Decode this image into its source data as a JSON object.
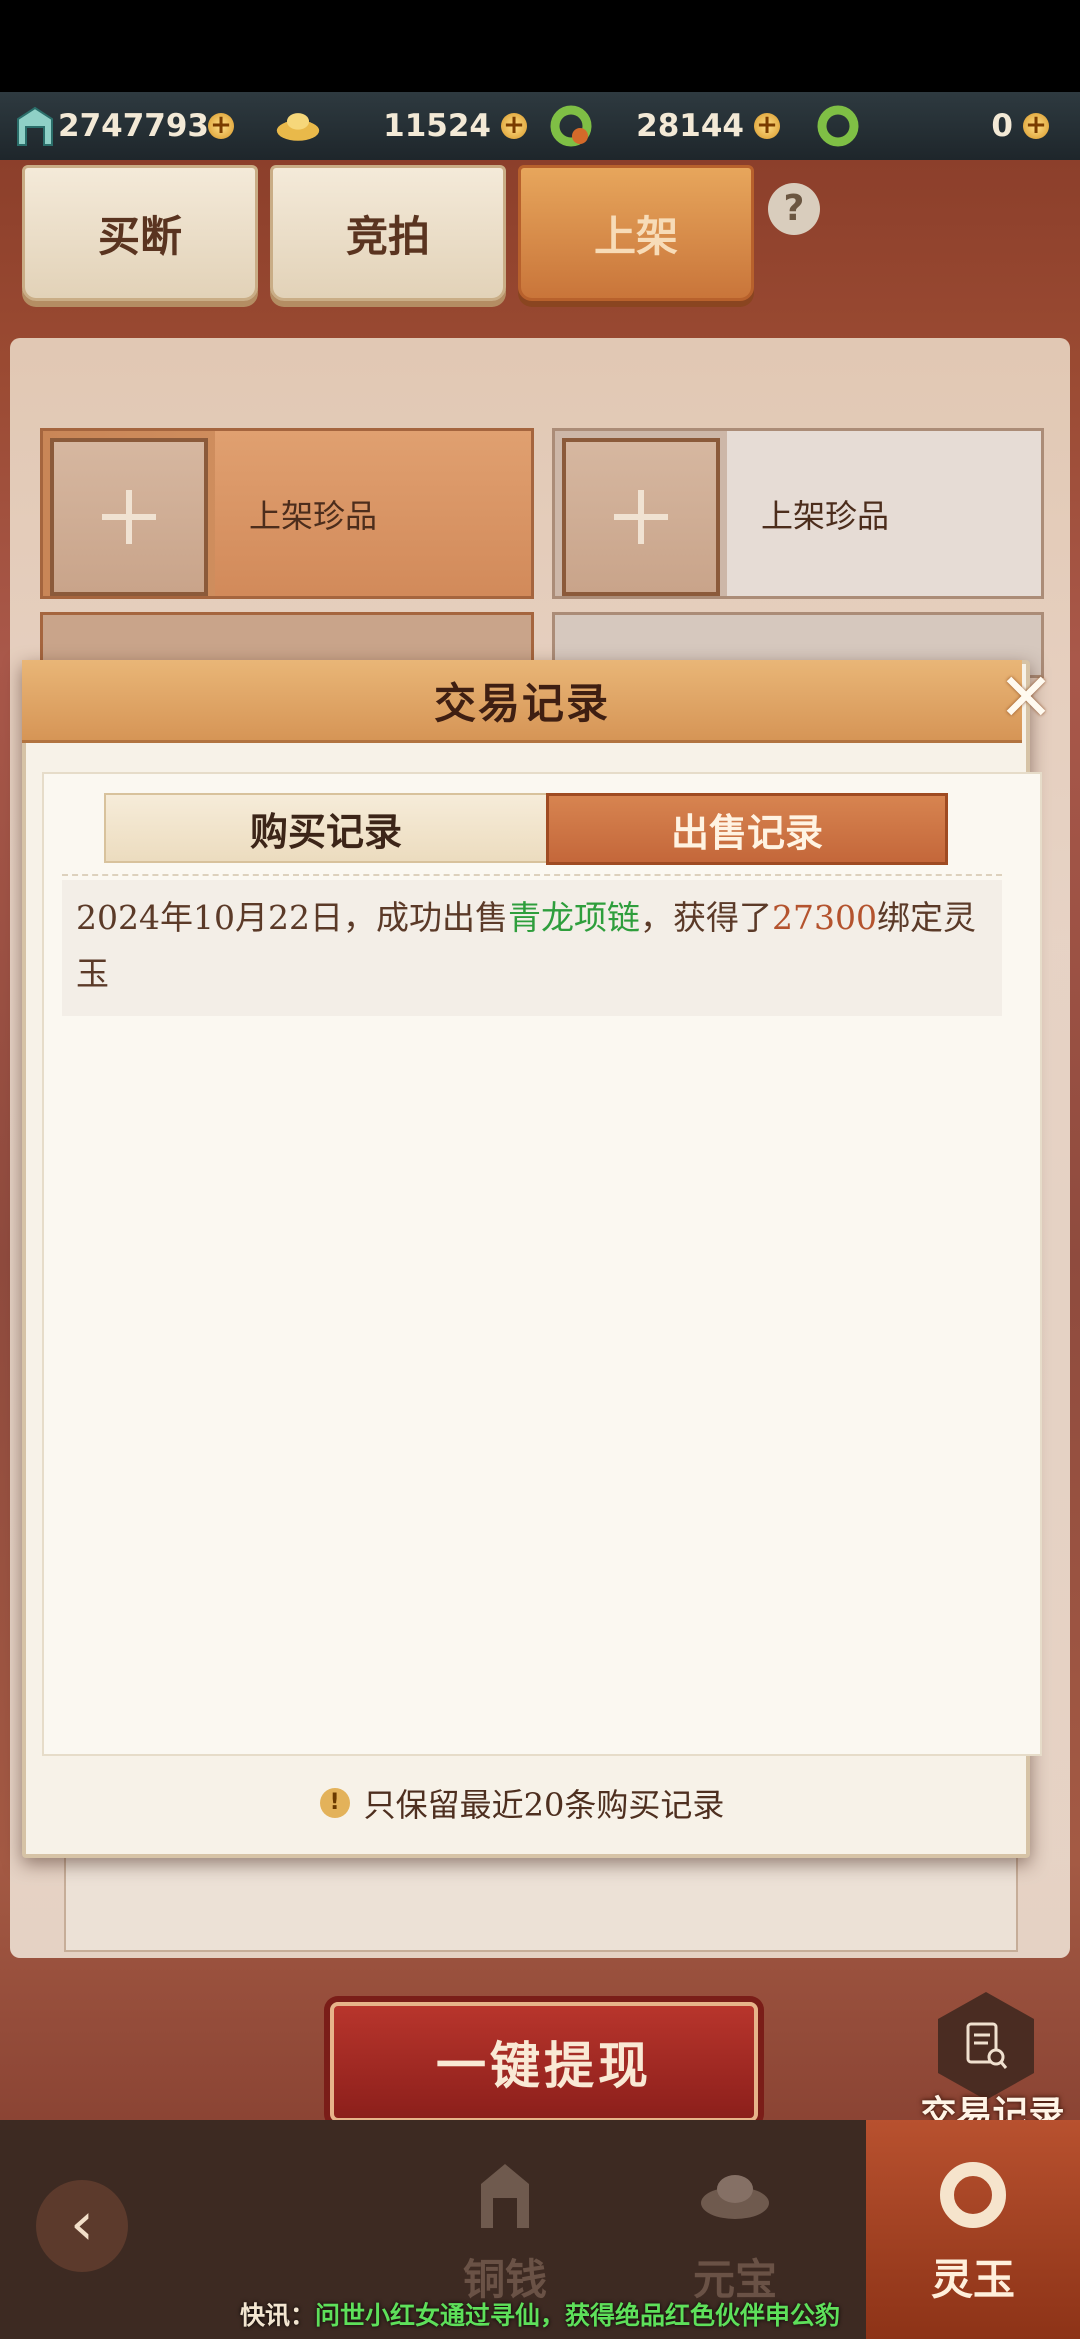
{
  "currencies": [
    {
      "icon": "copper-gate-icon",
      "value": "2747793"
    },
    {
      "icon": "gold-ingot-icon",
      "value": "11524"
    },
    {
      "icon": "bound-jade-ring-icon",
      "value": "28144"
    },
    {
      "icon": "jade-ring-icon",
      "value": "0"
    }
  ],
  "tabs": {
    "buyout": "买断",
    "auction": "竞拍",
    "list": "上架"
  },
  "slots": {
    "label_a": "上架珍品",
    "label_b": "上架珍品"
  },
  "modal": {
    "title": "交易记录",
    "segment_purchase": "购买记录",
    "segment_sale": "出售记录",
    "records": [
      {
        "date": "2024年10月22日，成功出售",
        "item": "青龙项链",
        "mid": "，获得了",
        "amount": "27300",
        "suffix": "绑定灵玉"
      }
    ],
    "note": "只保留最近20条购买记录"
  },
  "withdraw_label": "一键提现",
  "record_fab_label": "交易记录",
  "bottom_nav": {
    "copper": "铜钱",
    "ingot": "元宝",
    "jade": "灵玉"
  },
  "ticker": {
    "prefix": "快讯：",
    "highlight1": "问世小红女通过寻仙，获得绝品红色伙伴",
    "highlight2": "申公豹"
  }
}
